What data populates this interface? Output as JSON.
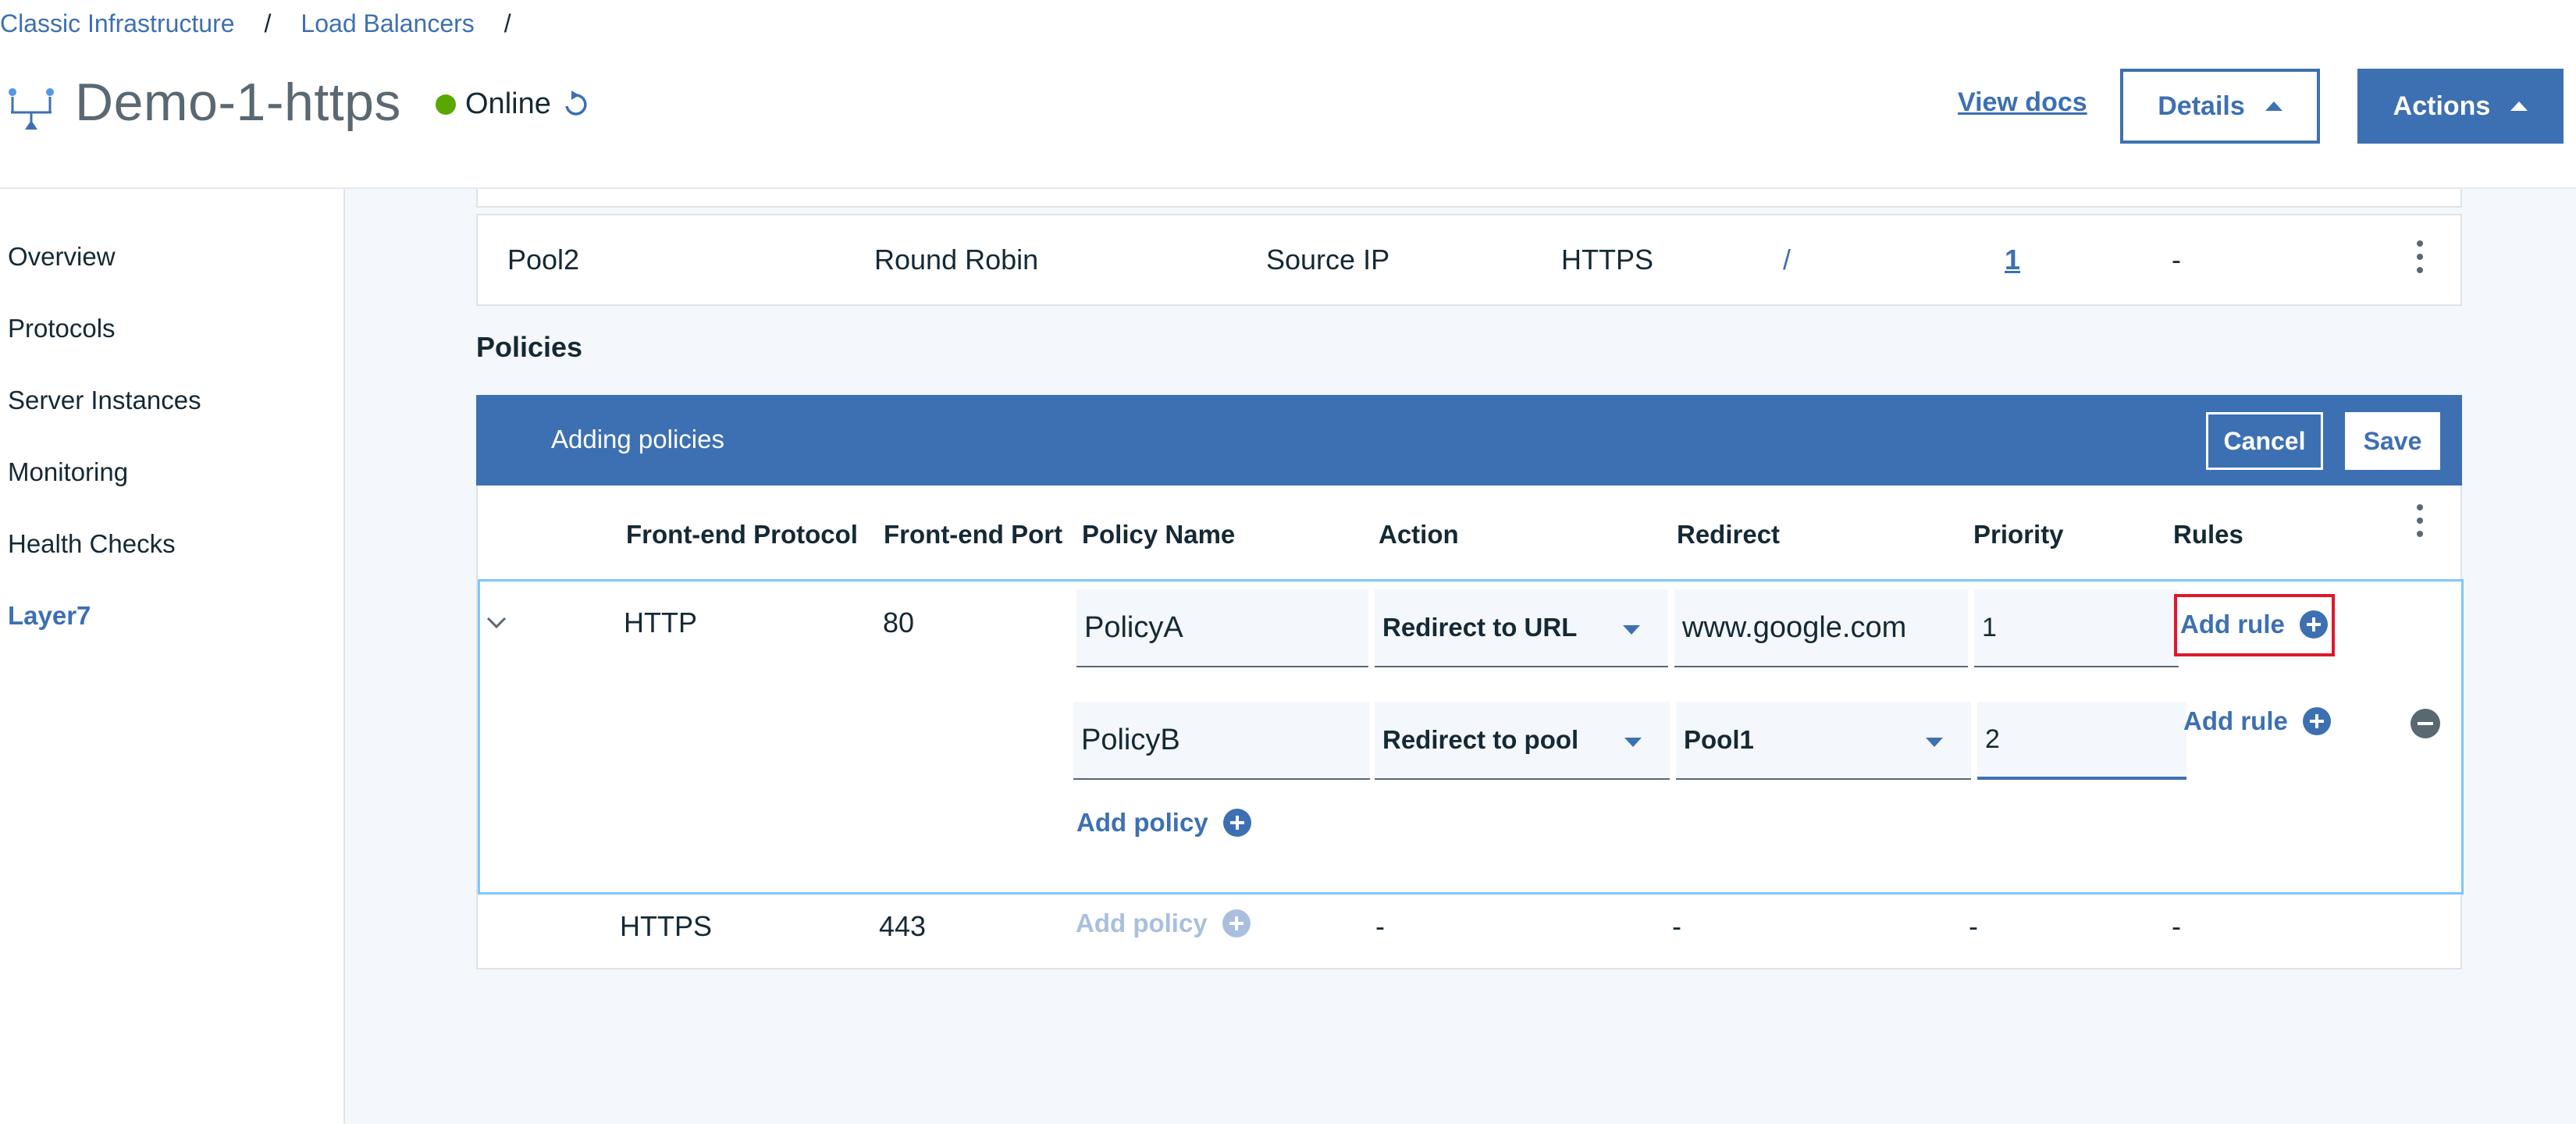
{
  "breadcrumb": {
    "items": [
      "Classic Infrastructure",
      "Load Balancers"
    ],
    "separator": "/"
  },
  "header": {
    "title": "Demo-1-https",
    "status": "Online",
    "view_docs": "View docs",
    "details_label": "Details",
    "actions_label": "Actions"
  },
  "sidebar": {
    "items": [
      {
        "label": "Overview",
        "active": false
      },
      {
        "label": "Protocols",
        "active": false
      },
      {
        "label": "Server Instances",
        "active": false
      },
      {
        "label": "Monitoring",
        "active": false
      },
      {
        "label": "Health Checks",
        "active": false
      },
      {
        "label": "Layer7",
        "active": true
      }
    ]
  },
  "pool_row": {
    "name": "Pool2",
    "method": "Round Robin",
    "session": "Source IP",
    "protocol": "HTTPS",
    "path": "/",
    "members": "1",
    "extra": "-"
  },
  "policies": {
    "heading": "Policies",
    "banner_title": "Adding policies",
    "cancel_label": "Cancel",
    "save_label": "Save",
    "columns": [
      "Front-end Protocol",
      "Front-end Port",
      "Policy Name",
      "Action",
      "Redirect",
      "Priority",
      "Rules"
    ],
    "http_group": {
      "protocol": "HTTP",
      "port": "80",
      "rows": [
        {
          "policy_name": "PolicyA",
          "action": "Redirect to URL",
          "redirect": "www.google.com",
          "priority": "1",
          "rule_link": "Add rule"
        },
        {
          "policy_name": "PolicyB",
          "action": "Redirect to pool",
          "redirect": "Pool1",
          "priority": "2",
          "rule_link": "Add rule"
        }
      ],
      "add_policy": "Add policy"
    },
    "https_row": {
      "protocol": "HTTPS",
      "port": "443",
      "add_policy": "Add policy",
      "action": "-",
      "redirect": "-",
      "priority": "-",
      "rules": "-"
    }
  },
  "colors": {
    "accent": "#3d70b2",
    "status_online": "#5aa700",
    "highlight": "#e0182d",
    "focus_border": "#7cc7ff"
  }
}
